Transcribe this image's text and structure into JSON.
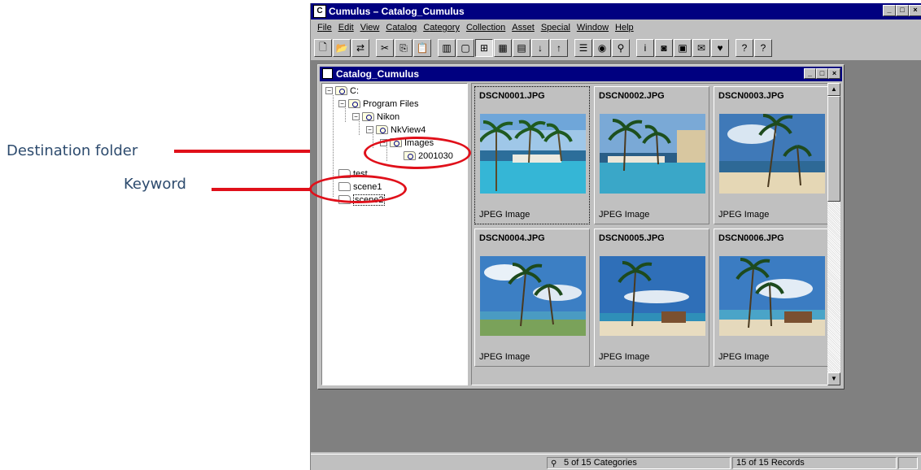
{
  "callouts": {
    "destination": "Destination folder",
    "keyword": "Keyword"
  },
  "app": {
    "title": "Cumulus – Catalog_Cumulus",
    "menu": [
      "File",
      "Edit",
      "View",
      "Catalog",
      "Category",
      "Collection",
      "Asset",
      "Special",
      "Window",
      "Help"
    ]
  },
  "child": {
    "title": "Catalog_Cumulus"
  },
  "tree": {
    "drive": "C:",
    "program_files": "Program Files",
    "nikon": "Nikon",
    "nkview": "NkView4",
    "images": "Images",
    "date_folder": "2001030",
    "test": "test",
    "scene1": "scene1",
    "scene2": "scene2"
  },
  "thumbnails": [
    {
      "name": "DSCN0001.JPG",
      "type": "JPEG Image"
    },
    {
      "name": "DSCN0002.JPG",
      "type": "JPEG Image"
    },
    {
      "name": "DSCN0003.JPG",
      "type": "JPEG Image"
    },
    {
      "name": "DSCN0004.JPG",
      "type": "JPEG Image"
    },
    {
      "name": "DSCN0005.JPG",
      "type": "JPEG Image"
    },
    {
      "name": "DSCN0006.JPG",
      "type": "JPEG Image"
    }
  ],
  "status": {
    "categories": "5 of 15 Categories",
    "records": "15 of 15 Records"
  },
  "colors": {
    "titlebar": "#000080",
    "callout": "#e0101a",
    "callout_text": "#2d4b6e"
  }
}
